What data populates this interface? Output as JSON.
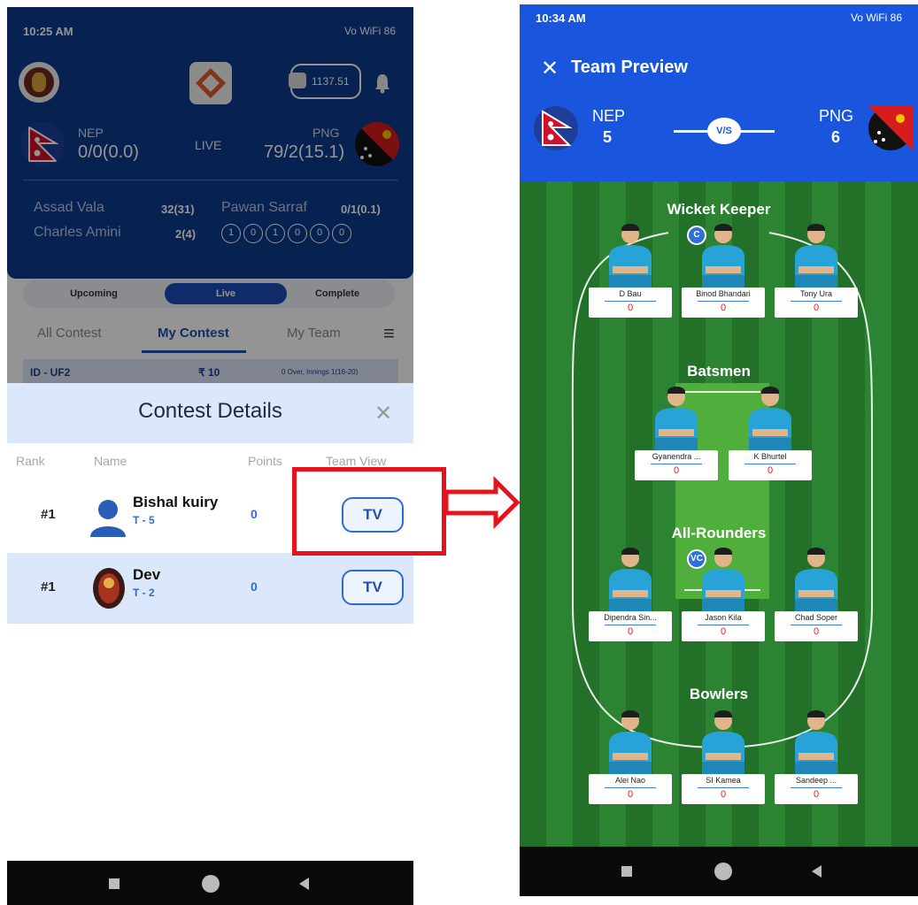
{
  "left_screen": {
    "status_time": "10:25 AM",
    "status_icons": "Vo WiFi 86",
    "wallet_amount": "1137.51",
    "team1": {
      "code": "NEP",
      "score": "0/0(0.0)"
    },
    "team2": {
      "code": "PNG",
      "score": "79/2(15.1)"
    },
    "live_label": "LIVE",
    "batter1": {
      "name": "Assad Vala",
      "stat": "32(31)"
    },
    "batter2": {
      "name": "Charles Amini",
      "stat": "2(4)"
    },
    "bowler": {
      "name": "Pawan Sarraf",
      "stat": "0/1(0.1)"
    },
    "balls": [
      "1",
      "0",
      "1",
      "0",
      "0",
      "0"
    ],
    "segments": [
      "Upcoming",
      "Live",
      "Complete"
    ],
    "tabs": [
      "All Contest",
      "My Contest",
      "My Team"
    ],
    "contest_strip": {
      "id": "ID - UF2",
      "fee": "₹ 10",
      "info": "0 Over, Innings 1(16-20)"
    },
    "sheet": {
      "title": "Contest Details",
      "columns": [
        "Rank",
        "Name",
        "Points",
        "Team View"
      ],
      "rows": [
        {
          "rank": "#1",
          "name": "Bishal kuiry",
          "team": "T - 5",
          "points": "0",
          "button": "TV"
        },
        {
          "rank": "#1",
          "name": "Dev",
          "team": "T - 2",
          "points": "0",
          "button": "TV"
        }
      ]
    }
  },
  "right_screen": {
    "status_time": "10:34 AM",
    "status_icons": "Vo WiFi 86",
    "title": "Team Preview",
    "team1": {
      "code": "NEP",
      "count": "5"
    },
    "team2": {
      "code": "PNG",
      "count": "6"
    },
    "vs_label": "V/S",
    "sections": [
      {
        "label": "Wicket Keeper",
        "players": [
          {
            "name": "D Bau",
            "points": "0"
          },
          {
            "name": "Binod Bhandari",
            "points": "0",
            "badge": "C"
          },
          {
            "name": "Tony Ura",
            "points": "0"
          }
        ]
      },
      {
        "label": "Batsmen",
        "players": [
          {
            "name": "Gyanendra ...",
            "points": "0"
          },
          {
            "name": "K Bhurtel",
            "points": "0"
          }
        ]
      },
      {
        "label": "All-Rounders",
        "players": [
          {
            "name": "Dipendra Sin...",
            "points": "0"
          },
          {
            "name": "Jason Kila",
            "points": "0",
            "badge": "VC"
          },
          {
            "name": "Chad Soper",
            "points": "0"
          }
        ]
      },
      {
        "label": "Bowlers",
        "players": [
          {
            "name": "Alei Nao",
            "points": "0"
          },
          {
            "name": "SI Kamea",
            "points": "0"
          },
          {
            "name": "Sandeep ...",
            "points": "0"
          }
        ]
      }
    ]
  },
  "colors": {
    "brand_blue": "#0d3a8c",
    "preview_blue": "#1a56dd",
    "field_green": "#2e8a35",
    "annotation_red": "#e8121c",
    "accent_blue": "#2d6ad1"
  }
}
